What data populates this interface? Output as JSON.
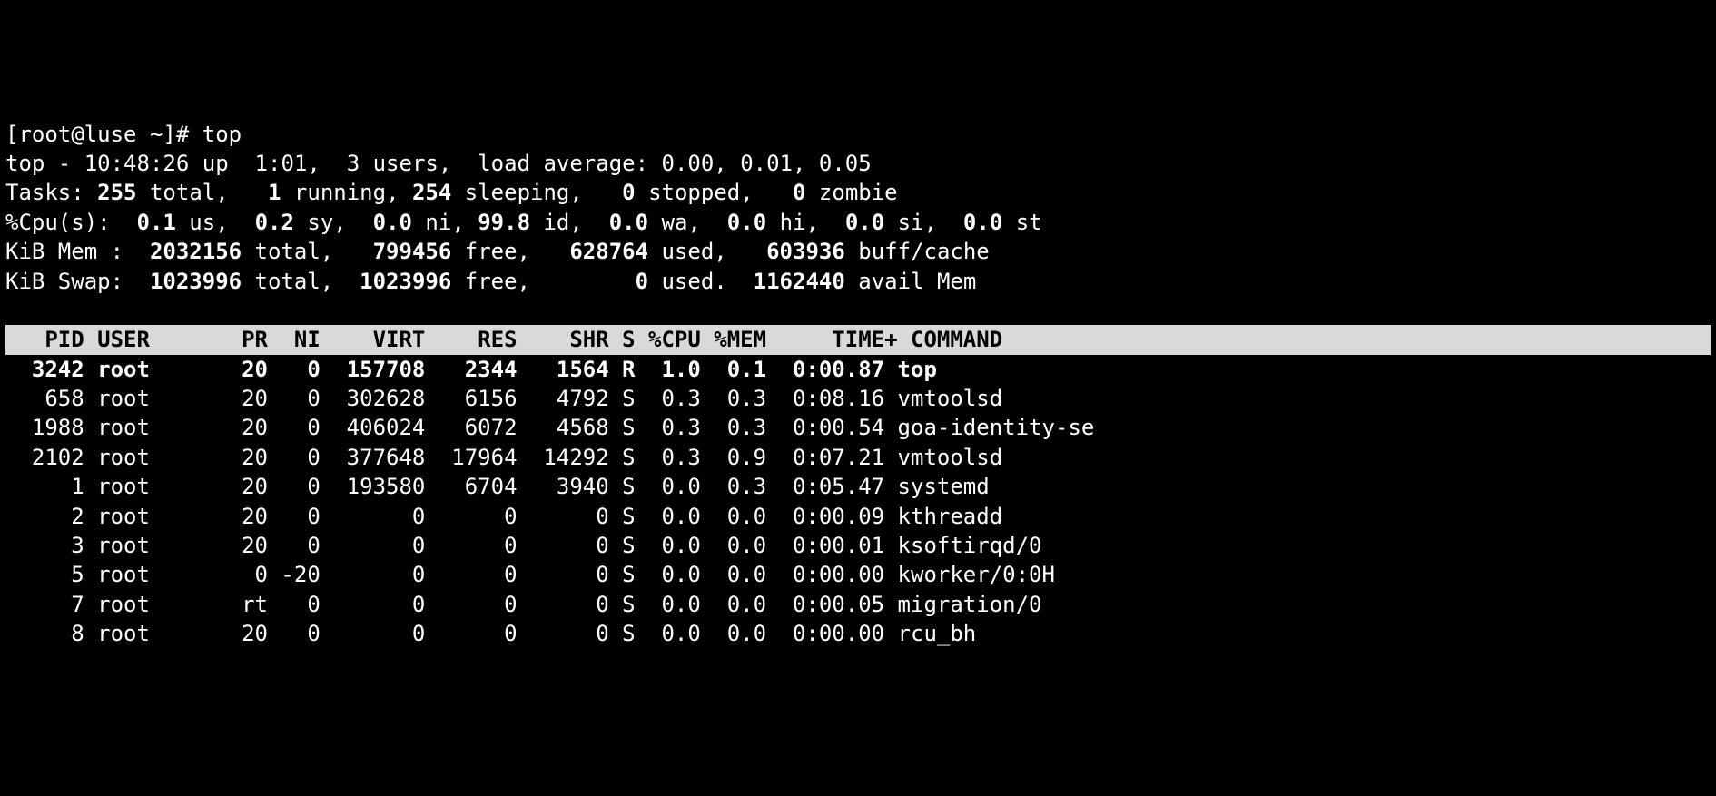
{
  "prompt_line": "[root@luse ~]# top",
  "summary": {
    "line1_prefix": "top - ",
    "time": "10:48:26",
    "line1_mid1": " up  ",
    "uptime": "1:01",
    "line1_mid2": ",  ",
    "users": "3",
    "line1_mid3": " users,  load average: ",
    "load": "0.00, 0.01, 0.05"
  },
  "tasks": {
    "prefix": "Tasks: ",
    "total": "255",
    "mid1": " total,   ",
    "running": "1",
    "mid2": " running, ",
    "sleeping": "254",
    "mid3": " sleeping,   ",
    "stopped": "0",
    "mid4": " stopped,   ",
    "zombie": "0",
    "mid5": " zombie"
  },
  "cpu": {
    "prefix": "%Cpu(s):  ",
    "us": "0.1",
    "us_l": " us,  ",
    "sy": "0.2",
    "sy_l": " sy,  ",
    "ni": "0.0",
    "ni_l": " ni, ",
    "id": "99.8",
    "id_l": " id,  ",
    "wa": "0.0",
    "wa_l": " wa,  ",
    "hi": "0.0",
    "hi_l": " hi,  ",
    "si": "0.0",
    "si_l": " si,  ",
    "st": "0.0",
    "st_l": " st"
  },
  "mem": {
    "prefix": "KiB Mem :  ",
    "total": "2032156",
    "total_l": " total,   ",
    "free": "799456",
    "free_l": " free,   ",
    "used": "628764",
    "used_l": " used,   ",
    "buff": "603936",
    "buff_l": " buff/cache"
  },
  "swap": {
    "prefix": "KiB Swap:  ",
    "total": "1023996",
    "total_l": " total,  ",
    "free": "1023996",
    "free_l": " free,        ",
    "used": "0",
    "used_l": " used.  ",
    "avail": "1162440",
    "avail_l": " avail Mem"
  },
  "columns": {
    "pid": "PID",
    "user": "USER",
    "pr": "PR",
    "ni": "NI",
    "virt": "VIRT",
    "res": "RES",
    "shr": "SHR",
    "s": "S",
    "cpu": "%CPU",
    "mem": "%MEM",
    "time": "TIME+",
    "cmd": "COMMAND"
  },
  "processes": [
    {
      "pid": "3242",
      "user": "root",
      "pr": "20",
      "ni": "0",
      "virt": "157708",
      "res": "2344",
      "shr": "1564",
      "s": "R",
      "cpu": "1.0",
      "mem": "0.1",
      "time": "0:00.87",
      "cmd": "top",
      "bold": true
    },
    {
      "pid": "658",
      "user": "root",
      "pr": "20",
      "ni": "0",
      "virt": "302628",
      "res": "6156",
      "shr": "4792",
      "s": "S",
      "cpu": "0.3",
      "mem": "0.3",
      "time": "0:08.16",
      "cmd": "vmtoolsd"
    },
    {
      "pid": "1988",
      "user": "root",
      "pr": "20",
      "ni": "0",
      "virt": "406024",
      "res": "6072",
      "shr": "4568",
      "s": "S",
      "cpu": "0.3",
      "mem": "0.3",
      "time": "0:00.54",
      "cmd": "goa-identity-se"
    },
    {
      "pid": "2102",
      "user": "root",
      "pr": "20",
      "ni": "0",
      "virt": "377648",
      "res": "17964",
      "shr": "14292",
      "s": "S",
      "cpu": "0.3",
      "mem": "0.9",
      "time": "0:07.21",
      "cmd": "vmtoolsd"
    },
    {
      "pid": "1",
      "user": "root",
      "pr": "20",
      "ni": "0",
      "virt": "193580",
      "res": "6704",
      "shr": "3940",
      "s": "S",
      "cpu": "0.0",
      "mem": "0.3",
      "time": "0:05.47",
      "cmd": "systemd"
    },
    {
      "pid": "2",
      "user": "root",
      "pr": "20",
      "ni": "0",
      "virt": "0",
      "res": "0",
      "shr": "0",
      "s": "S",
      "cpu": "0.0",
      "mem": "0.0",
      "time": "0:00.09",
      "cmd": "kthreadd"
    },
    {
      "pid": "3",
      "user": "root",
      "pr": "20",
      "ni": "0",
      "virt": "0",
      "res": "0",
      "shr": "0",
      "s": "S",
      "cpu": "0.0",
      "mem": "0.0",
      "time": "0:00.01",
      "cmd": "ksoftirqd/0"
    },
    {
      "pid": "5",
      "user": "root",
      "pr": "0",
      "ni": "-20",
      "virt": "0",
      "res": "0",
      "shr": "0",
      "s": "S",
      "cpu": "0.0",
      "mem": "0.0",
      "time": "0:00.00",
      "cmd": "kworker/0:0H"
    },
    {
      "pid": "7",
      "user": "root",
      "pr": "rt",
      "ni": "0",
      "virt": "0",
      "res": "0",
      "shr": "0",
      "s": "S",
      "cpu": "0.0",
      "mem": "0.0",
      "time": "0:00.05",
      "cmd": "migration/0"
    },
    {
      "pid": "8",
      "user": "root",
      "pr": "20",
      "ni": "0",
      "virt": "0",
      "res": "0",
      "shr": "0",
      "s": "S",
      "cpu": "0.0",
      "mem": "0.0",
      "time": "0:00.00",
      "cmd": "rcu_bh"
    }
  ],
  "col_widths": {
    "pid": 6,
    "user": 9,
    "pr": 4,
    "ni": 4,
    "virt": 8,
    "res": 7,
    "shr": 7,
    "s": 2,
    "cpu": 5,
    "mem": 5,
    "time": 9,
    "cmd": 20
  }
}
